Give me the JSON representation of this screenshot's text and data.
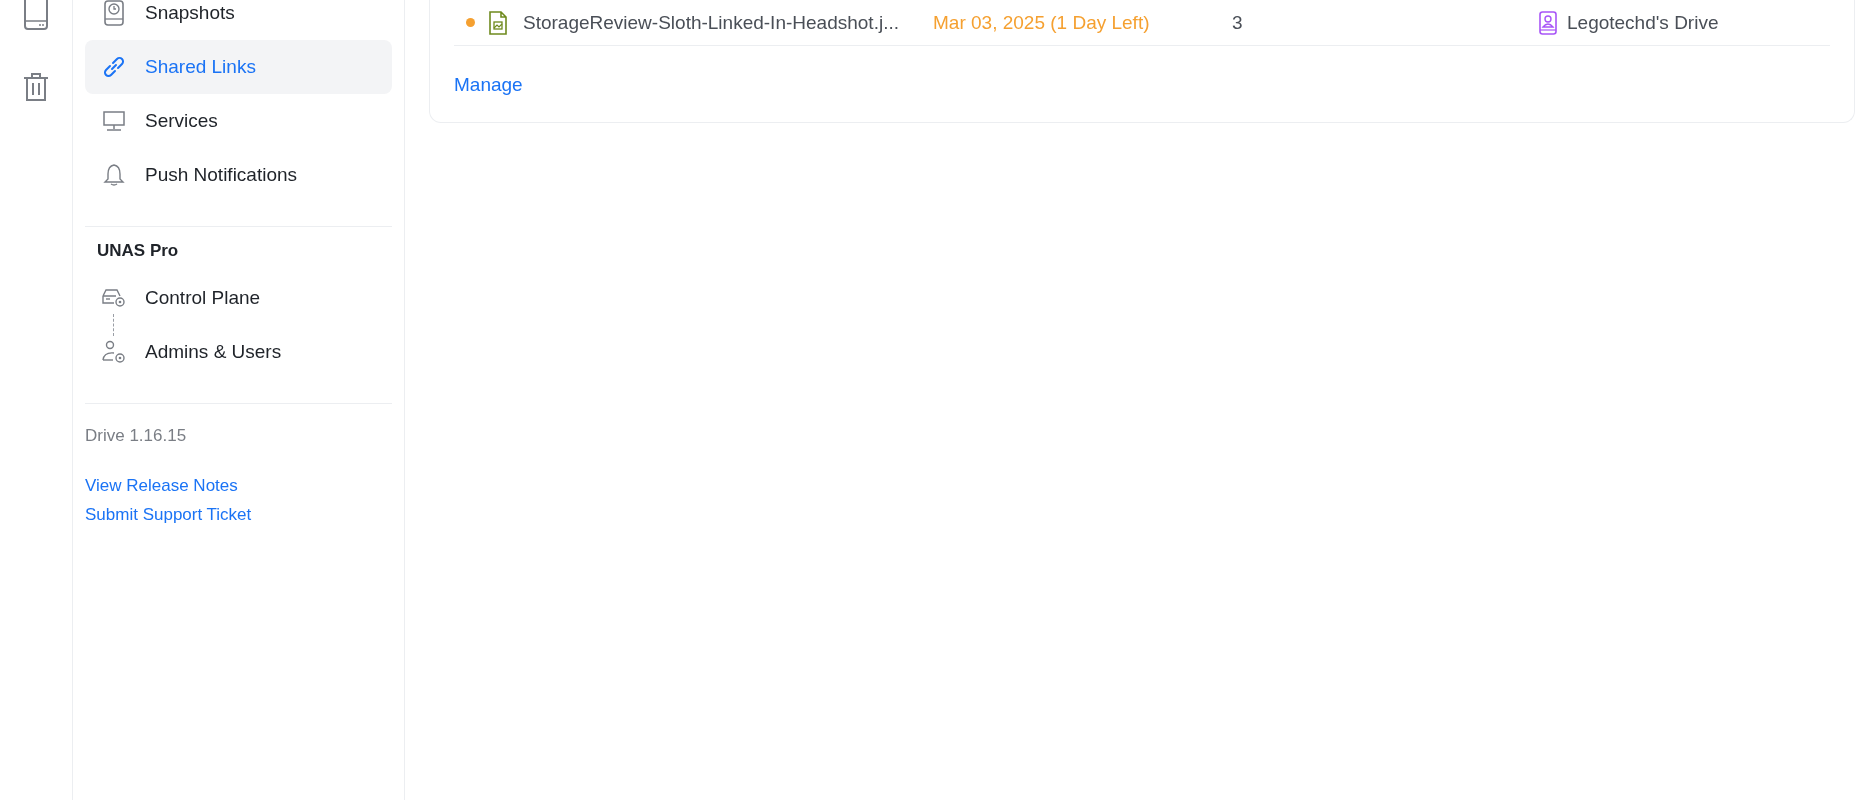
{
  "sidebar": {
    "items": [
      {
        "label": "Snapshots",
        "selected": false
      },
      {
        "label": "Shared Links",
        "selected": true
      },
      {
        "label": "Services",
        "selected": false
      },
      {
        "label": "Push Notifications",
        "selected": false
      }
    ],
    "section": {
      "title": "UNAS Pro",
      "items": [
        {
          "label": "Control Plane",
          "selected": false
        },
        {
          "label": "Admins & Users",
          "selected": false
        }
      ]
    },
    "version": "Drive 1.16.15",
    "links": [
      "View Release Notes",
      "Submit Support Ticket"
    ]
  },
  "shared_links": {
    "rows": [
      {
        "color": "#f5a030",
        "name": "StorageReview-Sloth-Linked-In-Headshot.j...",
        "expires": "Mar 03, 2025 (1 Day Left)",
        "expiring": true,
        "views": "3",
        "location": "Legotechd's Drive"
      }
    ],
    "manage": "Manage"
  }
}
